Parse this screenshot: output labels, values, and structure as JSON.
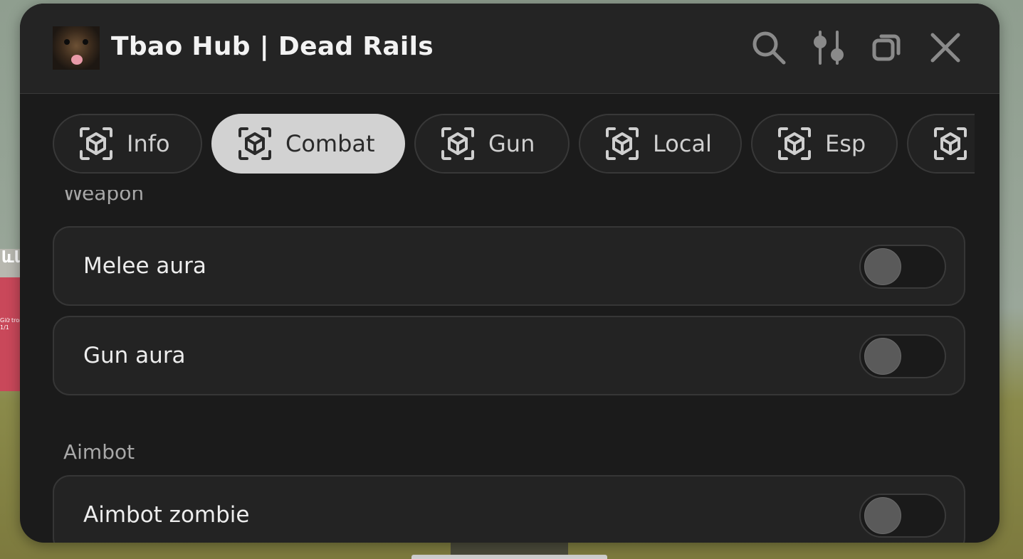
{
  "window": {
    "title": "Tbao Hub | Dead Rails",
    "avatar": "dog-avatar"
  },
  "toolbar": {
    "search_icon": "search-icon",
    "settings_icon": "sliders-icon",
    "minimize_icon": "windows-icon",
    "close_icon": "close-icon"
  },
  "tabs": [
    {
      "label": "Info",
      "active": false
    },
    {
      "label": "Combat",
      "active": true
    },
    {
      "label": "Gun",
      "active": false
    },
    {
      "label": "Local",
      "active": false
    },
    {
      "label": "Esp",
      "active": false
    },
    {
      "label": "",
      "active": false
    }
  ],
  "sections": [
    {
      "label": "Weapon",
      "items": [
        {
          "label": "Melee aura",
          "enabled": false
        },
        {
          "label": "Gun aura",
          "enabled": false
        }
      ]
    },
    {
      "label": "Aimbot",
      "items": [
        {
          "label": "Aimbot zombie",
          "enabled": false
        }
      ]
    }
  ],
  "background": {
    "side_text": "ևև",
    "side_note_1": "Giữ trong",
    "side_note_2": "1/1"
  },
  "colors": {
    "window_bg": "#1b1b1b",
    "active_tab": "#d2d2d2",
    "text": "#ededed"
  }
}
